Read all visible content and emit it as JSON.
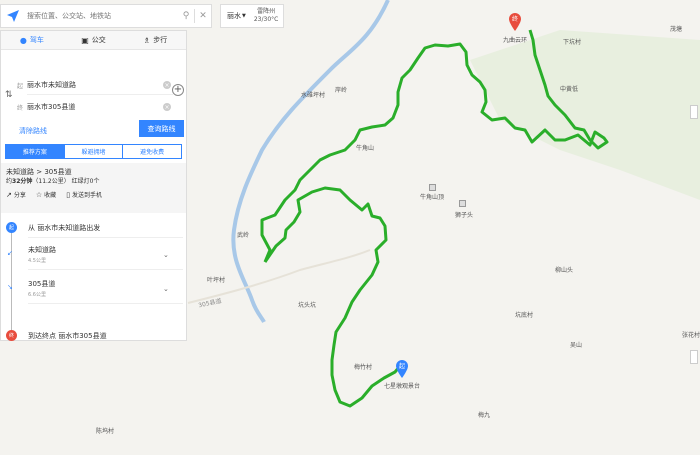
{
  "search": {
    "placeholder": "搜索位置、公交站、地铁站"
  },
  "city": {
    "name": "丽水",
    "weather_city": "雷降州",
    "temperature": "23/30°C"
  },
  "modes": [
    {
      "label": "驾车",
      "icon": "car-icon"
    },
    {
      "label": "公交",
      "icon": "bus-icon"
    },
    {
      "label": "步行",
      "icon": "walk-icon"
    }
  ],
  "route": {
    "start_tag": "起",
    "start_value": "丽水市未知道路",
    "end_tag": "终",
    "end_value": "丽水市305县道",
    "clear_label": "清除路线",
    "query_label": "查询路线"
  },
  "plans": [
    {
      "label": "推荐方案"
    },
    {
      "label": "躲避拥堵"
    },
    {
      "label": "避免收费"
    }
  ],
  "summary": {
    "route": "未知道路 > 305县道",
    "time_prefix": "约",
    "time": "32分钟",
    "distance": "（11.2公里）",
    "lights": "红绿灯0个",
    "share": "分享",
    "favorite": "收藏",
    "send": "发送到手机"
  },
  "steps": {
    "start_marker": "起",
    "start_text": "从 丽水市未知道路出发",
    "step1_main": "未知道路",
    "step1_dist": "4.5公里",
    "step2_main": "305县道",
    "step2_dist": "6.6公里",
    "end_marker": "终",
    "end_text": "到达终点 丽水市305县道"
  },
  "map_labels": {
    "place_label_1": "九曲云环",
    "place_label_2": "下坑村",
    "place_label_3": "茂塘",
    "place_label_4": "中黄低",
    "place_label_5": "水碓坪村",
    "place_label_6": "岸岭",
    "place_label_7": "牛角山",
    "place_label_8": "牛角山顶",
    "place_label_9": "狮子头",
    "place_label_10": "武岭",
    "place_label_11": "柳山头",
    "place_label_12": "叶坪村",
    "place_label_13": "坑头坑",
    "place_label_14": "坑底村",
    "place_label_15": "吴山",
    "place_label_16": "张花村",
    "place_label_17": "梅竹村",
    "place_label_18": "七星墩观景台",
    "place_label_19": "梅九",
    "place_label_20": "陈坞村",
    "road_label": "305县道"
  },
  "colors": {
    "route": "#2aae2a",
    "river": "#a8c8e8",
    "accent": "#3385ff",
    "end_pin": "#e84c3d",
    "start_pin": "#3385ff"
  }
}
